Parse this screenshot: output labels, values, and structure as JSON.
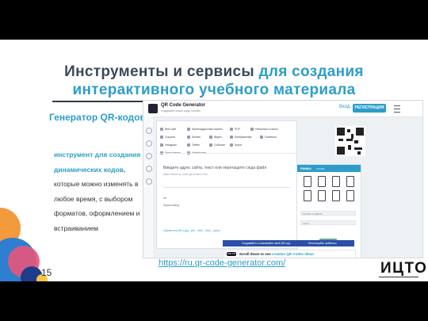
{
  "slide": {
    "title_line1_plain": "Инструменты и сервисы ",
    "title_line1_accent": "для создания",
    "title_line2_accent": "интерактивного учебного материала",
    "subheading": "Генератор QR-кодов",
    "desc_highlight": "инструмент для создания динамических кодов,",
    "desc_rest": "которые можно изменять в любое время, с выбором форматов, оформлением и встраиванием",
    "link": "https://ru.qr-code-generator.com/",
    "brand": "ИЦТО",
    "page_number": "15",
    "colors": {
      "accent": "#2e9dc9",
      "title": "#3a4a5a",
      "rule": "#2f3a4a"
    }
  },
  "screenshot": {
    "logo_title": "QR Code Generator",
    "logo_subtitle": "создавайте ваши коды онлайн",
    "login": "Вход",
    "register": "РЕГИСТРАЦИЯ",
    "types": [
      "Веб-сайт",
      "Мультиадресная ссылка",
      "PDF",
      "Несколько ссылок",
      "Соцсети",
      "Бизнес",
      "Видео",
      "Изображения",
      "Facebook",
      "Instagram",
      "Twitter",
      "Событие",
      "Купон",
      "Приложения",
      "Visitenkarte"
    ],
    "input_placeholder": "Введите адрес сайта, текст или перетащите сюда файл",
    "input_hint": "https://www.qr-code-generator.com",
    "sample_text_1": "url",
    "sample_text_2": "Supercoding",
    "upload_link": "Upload any file (.jpg, .pdf, .mp3, .docx, .pptx)",
    "frame_label": "РАМКА",
    "frame_sublabel": "FRAME",
    "shape_label": "ФОРМА И ЦВЕТА",
    "logo_label": "ЛОГО",
    "download_label": "DOWNLOAD",
    "promo_text": "Создавайте и скачивайте свой QR-код",
    "promo_text2": "Используйте шаблоны",
    "scroll_pill": "PRO TIP",
    "scroll_text": "Scroll down to see",
    "scroll_link": "creative QR Codes ideas"
  }
}
